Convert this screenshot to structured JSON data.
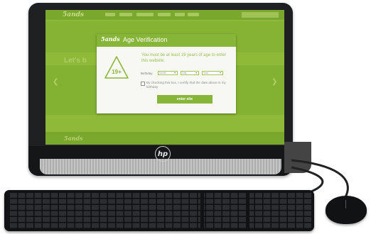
{
  "device": {
    "brand_logo_text": "hp"
  },
  "site": {
    "logo_text": "5ands",
    "hero_text": "Let's b",
    "footer_logo_text": "5ands"
  },
  "modal": {
    "logo_text": "5ands",
    "title": "Age Verification",
    "age_badge": "19+",
    "message": "You must be at least 19 years of age to enter this website.",
    "birthday_label": "Birthday",
    "birthday": {
      "month_placeholder": "Month",
      "day_placeholder": "Day",
      "year_placeholder": "Year"
    },
    "checkbox_label": "By checking this box, I certify that the date above is my birthday",
    "checkbox_checked": false,
    "enter_button_label": "enter site"
  },
  "colors": {
    "brand_green": "#87b537",
    "screen_green": "#8fb938"
  }
}
